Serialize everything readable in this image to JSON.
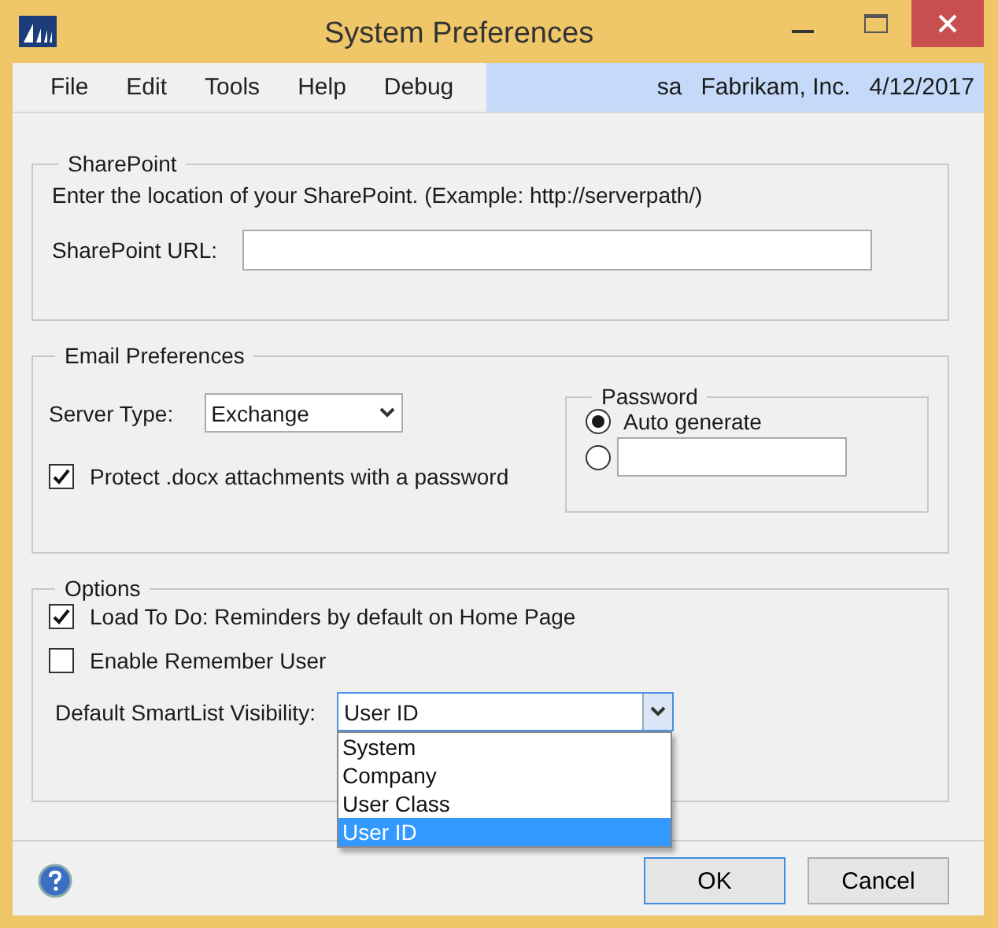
{
  "window": {
    "title": "System Preferences"
  },
  "menu": [
    {
      "label": "File"
    },
    {
      "label": "Edit"
    },
    {
      "label": "Tools"
    },
    {
      "label": "Help"
    },
    {
      "label": "Debug"
    }
  ],
  "status": {
    "user": "sa",
    "company": "Fabrikam, Inc.",
    "date": "4/12/2017"
  },
  "sharepoint": {
    "title": "SharePoint",
    "description": "Enter the location of your SharePoint. (Example: http://serverpath/)",
    "url_label": "SharePoint URL:"
  },
  "email": {
    "title": "Email Preferences",
    "server_type_label": "Server Type:",
    "server_type": "Exchange",
    "protect": {
      "label": "Protect .docx attachments with a password",
      "checked": true
    },
    "password": {
      "title": "Password",
      "options": [
        {
          "kind": "label",
          "label": "Auto generate",
          "selected": true
        },
        {
          "kind": "field",
          "selected": false
        }
      ]
    }
  },
  "options": {
    "title": "Options",
    "checkboxes": [
      {
        "label": "Load To Do: Reminders by default on Home Page",
        "checked": true
      },
      {
        "label": "Enable Remember User",
        "checked": false
      }
    ],
    "smartlist": {
      "label": "Default SmartList Visibility:",
      "value": "User ID",
      "expanded": true,
      "items": [
        {
          "label": "System",
          "selected": false
        },
        {
          "label": "Company",
          "selected": false
        },
        {
          "label": "User Class",
          "selected": false
        },
        {
          "label": "User ID",
          "selected": true
        }
      ]
    }
  },
  "buttons": [
    {
      "label": "OK",
      "default": true
    },
    {
      "label": "Cancel",
      "default": false
    }
  ]
}
